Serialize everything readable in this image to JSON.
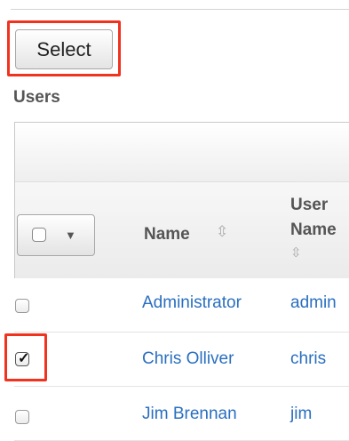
{
  "toolbar": {
    "select_label": "Select"
  },
  "section": {
    "title": "Users"
  },
  "table": {
    "headers": {
      "name": "Name",
      "user_name_line1": "User",
      "user_name_line2": "Name"
    },
    "rows": [
      {
        "name": "Administrator",
        "user_name": "admin",
        "checked": false
      },
      {
        "name": "Chris Olliver",
        "user_name": "chris",
        "checked": true
      },
      {
        "name": "Jim Brennan",
        "user_name": "jim",
        "checked": false
      }
    ]
  },
  "icons": {
    "sort": "up-down-sort-icon",
    "caret": "caret-down-icon",
    "check": "check-mark-icon"
  },
  "colors": {
    "highlight": "#f0321e",
    "link": "#2a6fc0"
  }
}
